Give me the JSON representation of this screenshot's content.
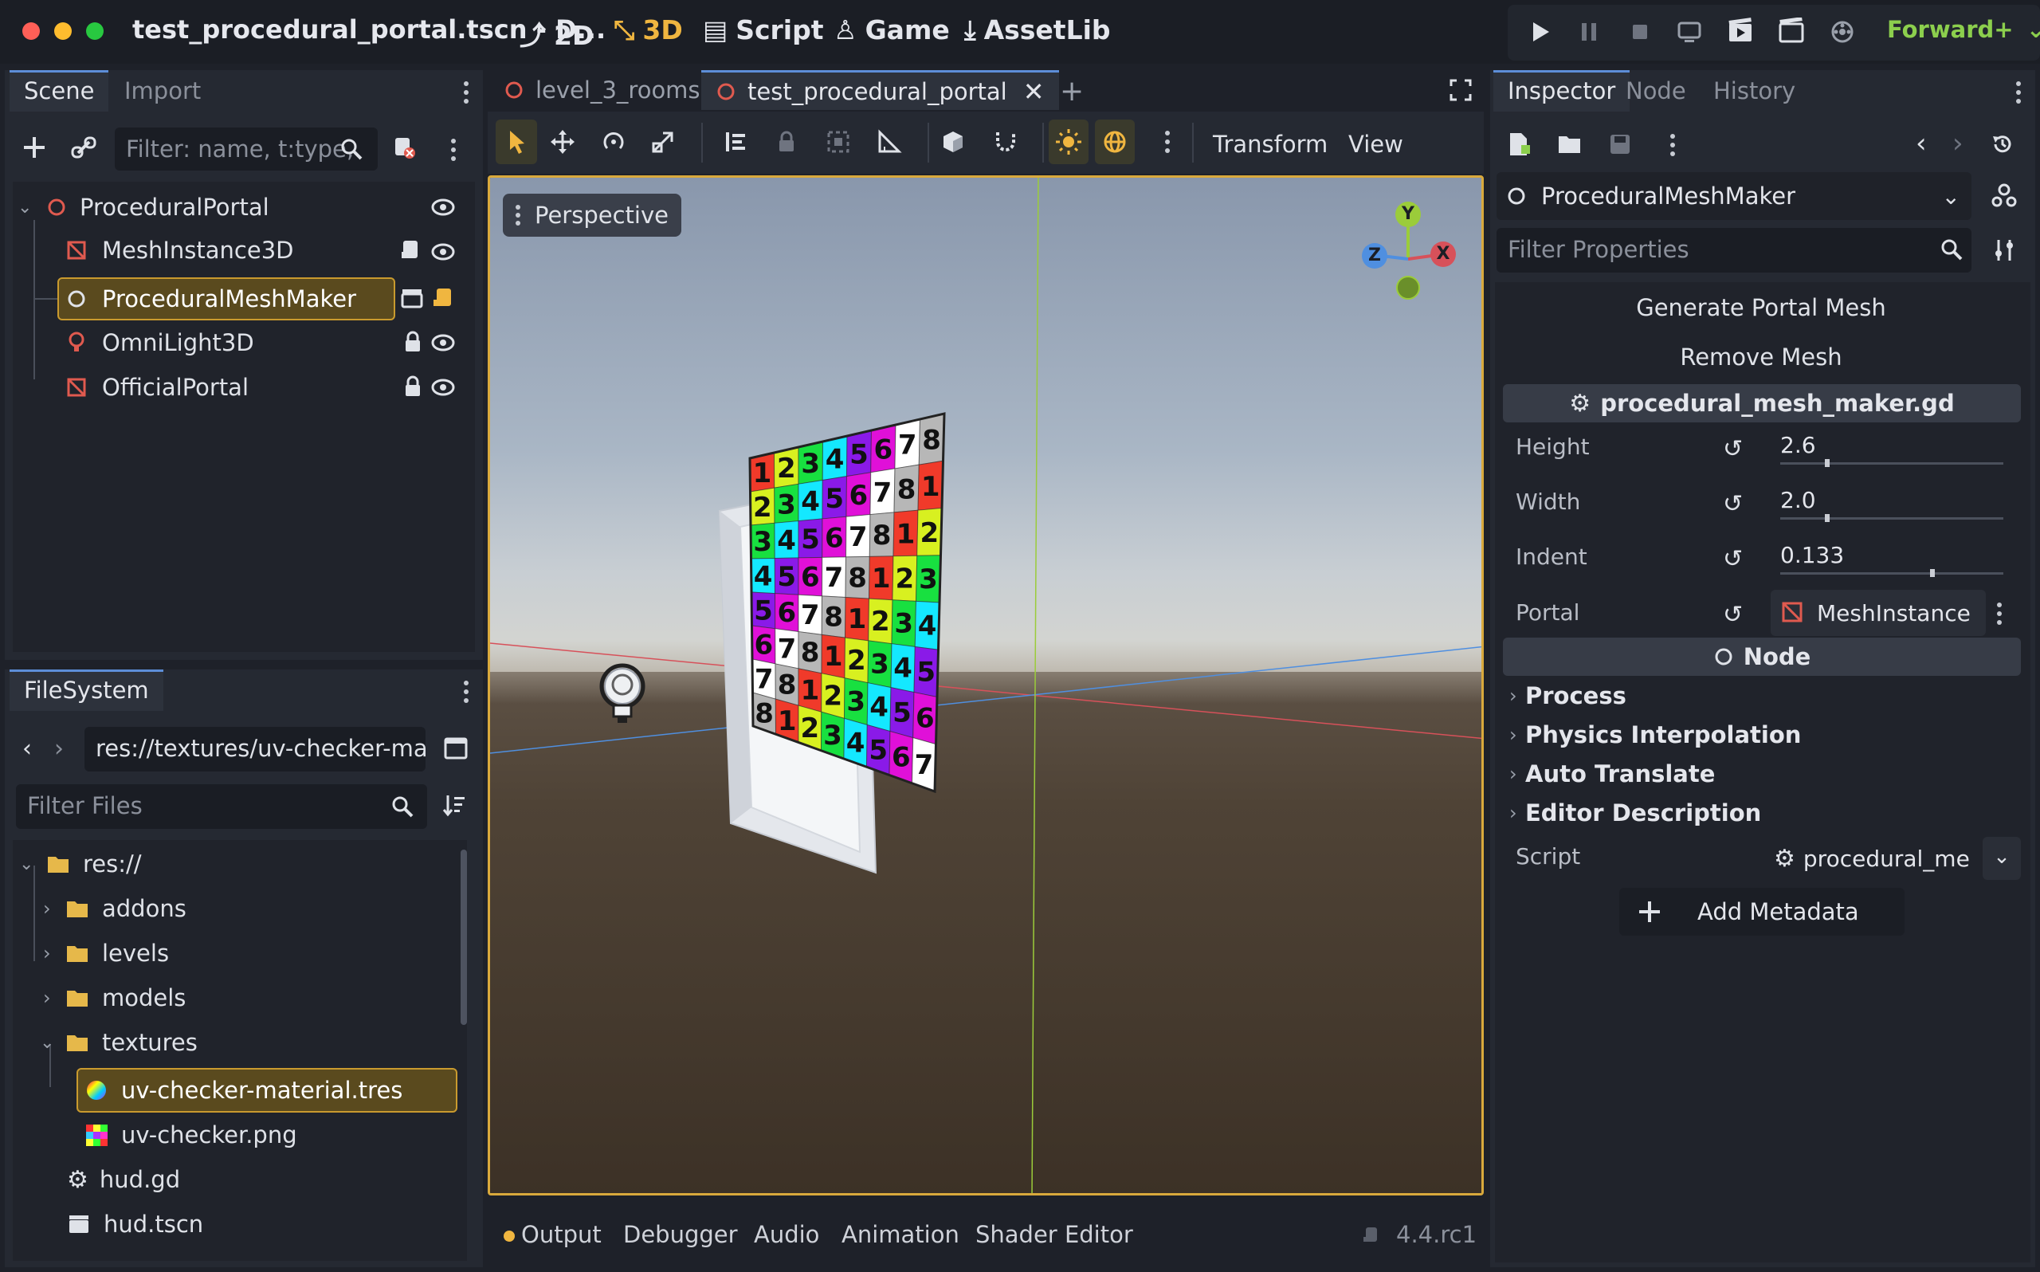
{
  "window": {
    "title": "test_procedural_portal.tscn - D...",
    "workspaces": [
      {
        "label": "2D",
        "active": false
      },
      {
        "label": "3D",
        "active": true
      },
      {
        "label": "Script",
        "active": false
      },
      {
        "label": "Game",
        "active": false
      },
      {
        "label": "AssetLib",
        "active": false
      }
    ],
    "renderer": "Forward+",
    "accent_color": "#f0b640"
  },
  "scene_dock": {
    "tabs": [
      "Scene",
      "Import"
    ],
    "filter_placeholder": "Filter: name, t:type,",
    "tree": [
      {
        "name": "ProceduralPortal",
        "icon": "node3d-ring-icon",
        "color": "#e05a4f"
      },
      {
        "name": "MeshInstance3D",
        "icon": "mesh-instance-icon",
        "color": "#e05a4f"
      },
      {
        "name": "ProceduralMeshMaker",
        "icon": "node-ring-icon",
        "selected": true
      },
      {
        "name": "OmniLight3D",
        "icon": "omni-light-icon",
        "color": "#e05a4f"
      },
      {
        "name": "OfficialPortal",
        "icon": "mesh-instance-icon",
        "color": "#e05a4f"
      }
    ]
  },
  "filesystem_dock": {
    "tab": "FileSystem",
    "path": "res://textures/uv-checker-mat",
    "filter_placeholder": "Filter Files",
    "tree": [
      {
        "name": "res://",
        "type": "folder"
      },
      {
        "name": "addons",
        "type": "folder"
      },
      {
        "name": "levels",
        "type": "folder"
      },
      {
        "name": "models",
        "type": "folder"
      },
      {
        "name": "textures",
        "type": "folder"
      },
      {
        "name": "uv-checker-material.tres",
        "type": "material",
        "selected": true
      },
      {
        "name": "uv-checker.png",
        "type": "image"
      },
      {
        "name": "hud.gd",
        "type": "script"
      },
      {
        "name": "hud.tscn",
        "type": "scene"
      }
    ]
  },
  "editor_tabs": [
    {
      "label": "level_3_rooms",
      "active": false
    },
    {
      "label": "test_procedural_portal",
      "active": true
    }
  ],
  "viewport_toolbar": {
    "transform_menu": "Transform",
    "view_menu": "View"
  },
  "viewport": {
    "perspective_label": "Perspective",
    "gizmo": {
      "y": "Y",
      "x": "X",
      "z": "Z"
    },
    "checker_rows": [
      [
        "1",
        "2",
        "3",
        "4",
        "5",
        "6",
        "7",
        "8"
      ],
      [
        "2",
        "3",
        "4",
        "5",
        "6",
        "7",
        "8",
        "1"
      ],
      [
        "3",
        "4",
        "5",
        "6",
        "7",
        "8",
        "1",
        "2"
      ],
      [
        "4",
        "5",
        "6",
        "7",
        "8",
        "1",
        "2",
        "3"
      ],
      [
        "5",
        "6",
        "7",
        "8",
        "1",
        "2",
        "3",
        "4"
      ],
      [
        "6",
        "7",
        "8",
        "1",
        "2",
        "3",
        "4",
        "5"
      ],
      [
        "7",
        "8",
        "1",
        "2",
        "3",
        "4",
        "5",
        "6"
      ],
      [
        "8",
        "1",
        "2",
        "3",
        "4",
        "5",
        "6",
        "7"
      ]
    ]
  },
  "bottom_panel": {
    "tabs": [
      "Output",
      "Debugger",
      "Audio",
      "Animation",
      "Shader Editor"
    ],
    "version": "4.4.rc1"
  },
  "inspector": {
    "tabs": [
      "Inspector",
      "Node",
      "History"
    ],
    "object_name": "ProceduralMeshMaker",
    "filter_placeholder": "Filter Properties",
    "buttons": {
      "generate": "Generate Portal Mesh",
      "remove": "Remove Mesh"
    },
    "script_group": "procedural_mesh_maker.gd",
    "properties": [
      {
        "label": "Height",
        "value": "2.6",
        "fraction": 0.2
      },
      {
        "label": "Width",
        "value": "2.0",
        "fraction": 0.2
      },
      {
        "label": "Indent",
        "value": "0.133",
        "fraction": 0.67
      }
    ],
    "portal": {
      "label": "Portal",
      "value": "MeshInstance"
    },
    "node_group": "Node",
    "sections": [
      "Process",
      "Physics Interpolation",
      "Auto Translate",
      "Editor Description"
    ],
    "script_row": {
      "label": "Script",
      "value": "procedural_me"
    },
    "add_metadata": "Add Metadata"
  }
}
